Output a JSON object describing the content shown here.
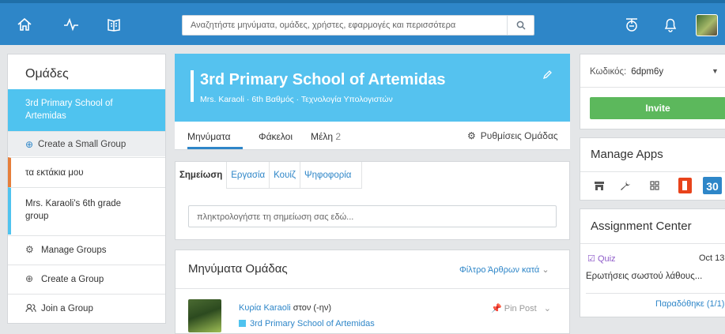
{
  "topbar": {
    "search_placeholder": "Αναζητήστε μηνύματα, ομάδες, χρήστες, εφαρμογές και περισσότερα"
  },
  "sidebar": {
    "title": "Ομάδες",
    "items": [
      {
        "label": "3rd Primary School of Artemidas"
      },
      {
        "label": "Create a Small Group"
      },
      {
        "label": "τα εκτάκια μου"
      },
      {
        "label": "Mrs. Karaoli's 6th grade group"
      },
      {
        "label": "Manage Groups"
      },
      {
        "label": "Create a Group"
      },
      {
        "label": "Join a Group"
      }
    ]
  },
  "group": {
    "name": "3rd Primary School of Artemidas",
    "subtitle": "Mrs. Karaoli · 6th Βαθμός · Τεχνολογία Υπολογιστών",
    "tabs": {
      "messages": "Μηνύματα",
      "folders": "Φάκελοι",
      "members": "Μέλη",
      "members_count": "2"
    },
    "settings_label": "Ρυθμίσεις Ομάδας"
  },
  "composer": {
    "tabs": [
      "Σημείωση",
      "Εργασία",
      "Κουίζ",
      "Ψηφοφορία"
    ],
    "placeholder": "πληκτρολογήστε τη σημείωση σας εδώ..."
  },
  "messages": {
    "title": "Μηνύματα Ομάδας",
    "filter_label": "Φίλτρο Άρθρων κατά",
    "post": {
      "author": "Κυρία Karaoli",
      "connector": "στον (-ην)",
      "group": "3rd Primary School of Artemidas",
      "pin_label": "Pin Post"
    }
  },
  "code_panel": {
    "label": "Κωδικός:",
    "value": "6dpm6y",
    "invite_label": "Invite"
  },
  "apps": {
    "title": "Manage Apps",
    "calendar_day": "30"
  },
  "assignments": {
    "title": "Assignment Center",
    "type": "Quiz",
    "date": "Oct 13",
    "description": "Ερωτήσεις σωστού λάθους...",
    "status": "Παραδόθηκε (1/1)"
  },
  "colors": {
    "brand": "#2e86c8",
    "group_header": "#55c2ef",
    "invite": "#5cb85c",
    "quiz": "#8e5bc9"
  }
}
